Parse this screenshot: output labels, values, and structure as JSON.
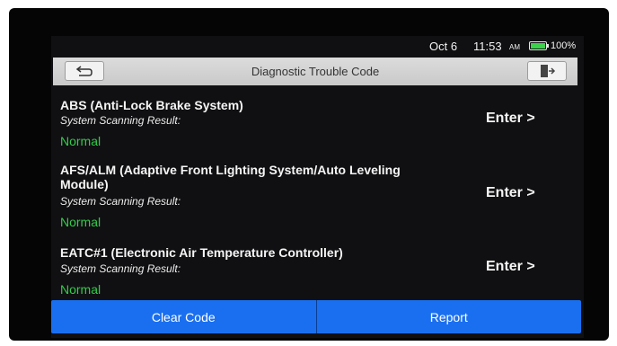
{
  "status": {
    "date": "Oct 6",
    "time": "11:53",
    "ampm": "AM",
    "battery": "100%",
    "battery_level": 1.0
  },
  "header": {
    "title": "Diagnostic Trouble Code",
    "back_icon": "back-arrow-icon",
    "exit_icon": "exit-door-icon"
  },
  "systems": [
    {
      "name": "ABS (Anti-Lock Brake System)",
      "scan_label": "System Scanning Result:",
      "result": "Normal",
      "action": "Enter >"
    },
    {
      "name": "AFS/ALM (Adaptive Front Lighting System/Auto Leveling Module)",
      "scan_label": "System Scanning Result:",
      "result": "Normal",
      "action": "Enter >"
    },
    {
      "name": "EATC#1 (Electronic Air Temperature Controller)",
      "scan_label": "System Scanning Result:",
      "result": "Normal",
      "action": "Enter >"
    }
  ],
  "footer": {
    "clear_label": "Clear Code",
    "report_label": "Report"
  },
  "colors": {
    "accent": "#1a6ff0",
    "normal": "#33cc4a",
    "background": "#101012"
  }
}
